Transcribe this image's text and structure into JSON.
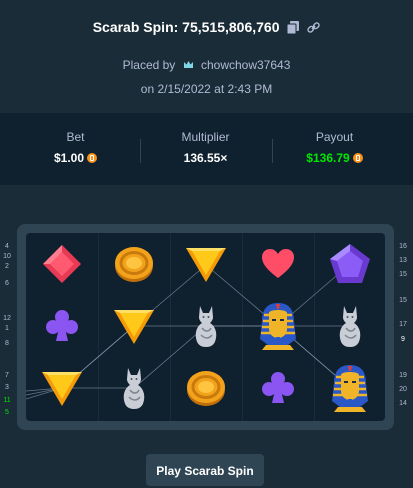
{
  "header": {
    "title": "Scarab Spin: 75,515,806,760",
    "placed_by_prefix": "Placed by",
    "username": "chowchow37643",
    "date": "on 2/15/2022 at 2:43 PM"
  },
  "stats": {
    "bet_label": "Bet",
    "bet_value": "$1.00",
    "multiplier_label": "Multiplier",
    "multiplier_value": "136.55×",
    "payout_label": "Payout",
    "payout_value": "$136.79"
  },
  "side_numbers_left": [
    "4",
    "10",
    "2",
    "6",
    "12",
    "1",
    "8",
    "7",
    "3",
    "11",
    "5"
  ],
  "side_numbers_right": [
    "16",
    "13",
    "15",
    "15",
    "17",
    "9",
    "19",
    "20",
    "14"
  ],
  "board": {
    "rows": [
      [
        "red-diamond-gem",
        "gold-coin",
        "yellow-triangle-gem",
        "red-heart",
        "purple-pentagon-gem"
      ],
      [
        "purple-club",
        "yellow-triangle-gem",
        "cat-statue",
        "pharaoh-mask",
        "cat-statue"
      ],
      [
        "yellow-triangle-gem",
        "cat-statue",
        "gold-coin",
        "purple-club",
        "pharaoh-mask"
      ]
    ]
  },
  "play_button": "Play Scarab Spin",
  "colors": {
    "background": "#1a2c38",
    "panel": "#0f212e",
    "border": "#2f4553",
    "payout_green": "#00e701",
    "muted_text": "#b1bad3"
  }
}
